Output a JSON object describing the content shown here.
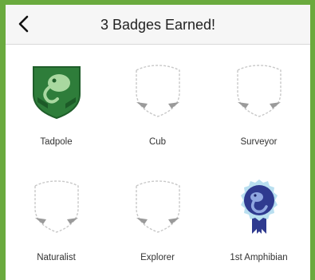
{
  "header": {
    "title": "3 Badges Earned!",
    "back_icon": "chevron-left-icon"
  },
  "badges": [
    {
      "label": "Tadpole",
      "earned": true,
      "icon": "tadpole-shield-icon",
      "color": "#2e7d3a"
    },
    {
      "label": "Cub",
      "earned": false,
      "icon": "empty-shield-icon"
    },
    {
      "label": "Surveyor",
      "earned": false,
      "icon": "empty-shield-icon"
    },
    {
      "label": "Naturalist",
      "earned": false,
      "icon": "empty-shield-icon"
    },
    {
      "label": "Explorer",
      "earned": false,
      "icon": "empty-shield-icon"
    },
    {
      "label": "1st Amphibian",
      "earned": true,
      "icon": "amphibian-rosette-icon",
      "color": "#2f3a8f"
    }
  ],
  "colors": {
    "frame": "#6aaa3e",
    "header_bg": "#f6f6f6"
  }
}
